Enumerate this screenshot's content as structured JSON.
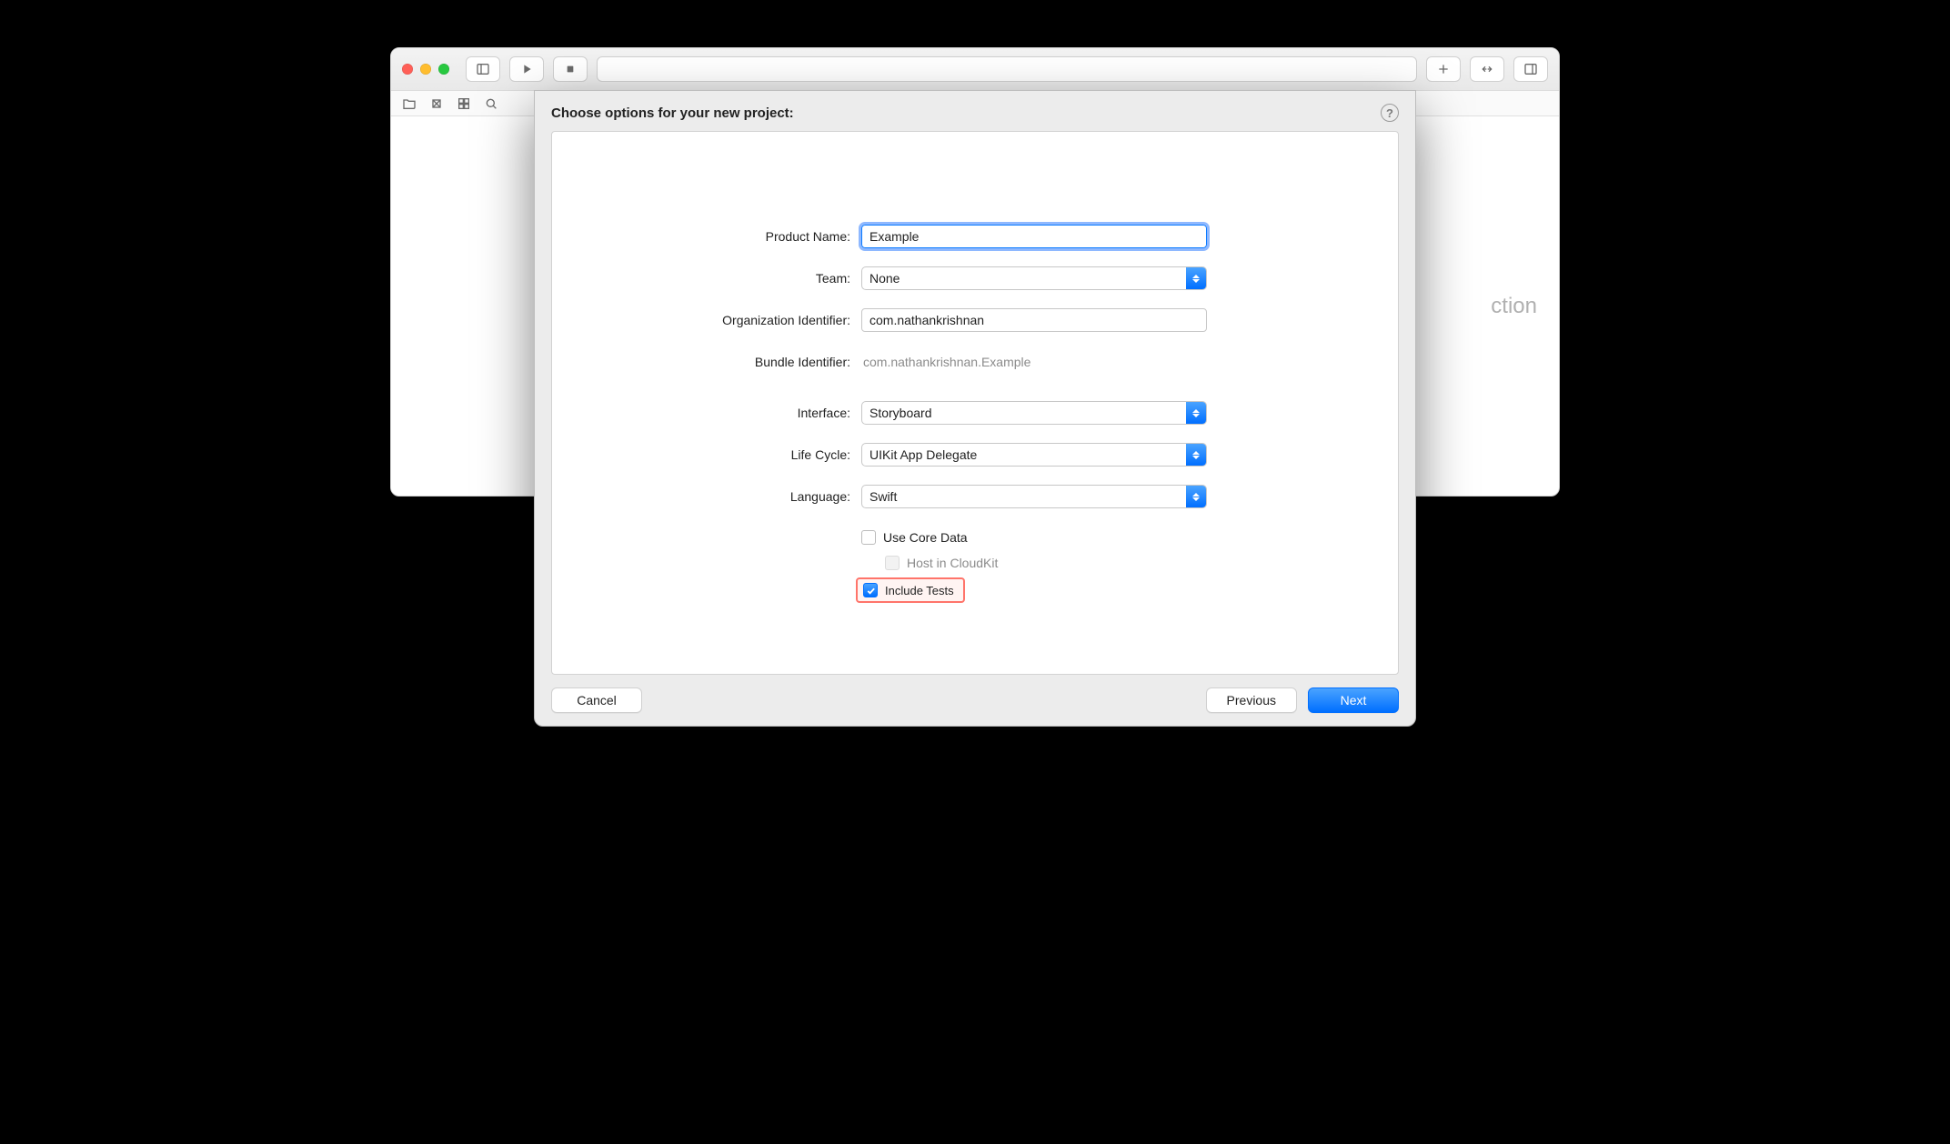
{
  "parent": {
    "no_selection": "ction"
  },
  "sheet": {
    "title": "Choose options for your new project:",
    "labels": {
      "product_name": "Product Name:",
      "team": "Team:",
      "organization_identifier": "Organization Identifier:",
      "bundle_identifier": "Bundle Identifier:",
      "interface": "Interface:",
      "life_cycle": "Life Cycle:",
      "language": "Language:"
    },
    "values": {
      "product_name": "Example",
      "team": "None",
      "organization_identifier": "com.nathankrishnan",
      "bundle_identifier": "com.nathankrishnan.Example",
      "interface": "Storyboard",
      "life_cycle": "UIKit App Delegate",
      "language": "Swift"
    },
    "checkboxes": {
      "use_core_data": {
        "label": "Use Core Data",
        "checked": false,
        "enabled": true
      },
      "host_cloudkit": {
        "label": "Host in CloudKit",
        "checked": false,
        "enabled": false
      },
      "include_tests": {
        "label": "Include Tests",
        "checked": true,
        "enabled": true
      }
    },
    "buttons": {
      "cancel": "Cancel",
      "previous": "Previous",
      "next": "Next"
    }
  }
}
